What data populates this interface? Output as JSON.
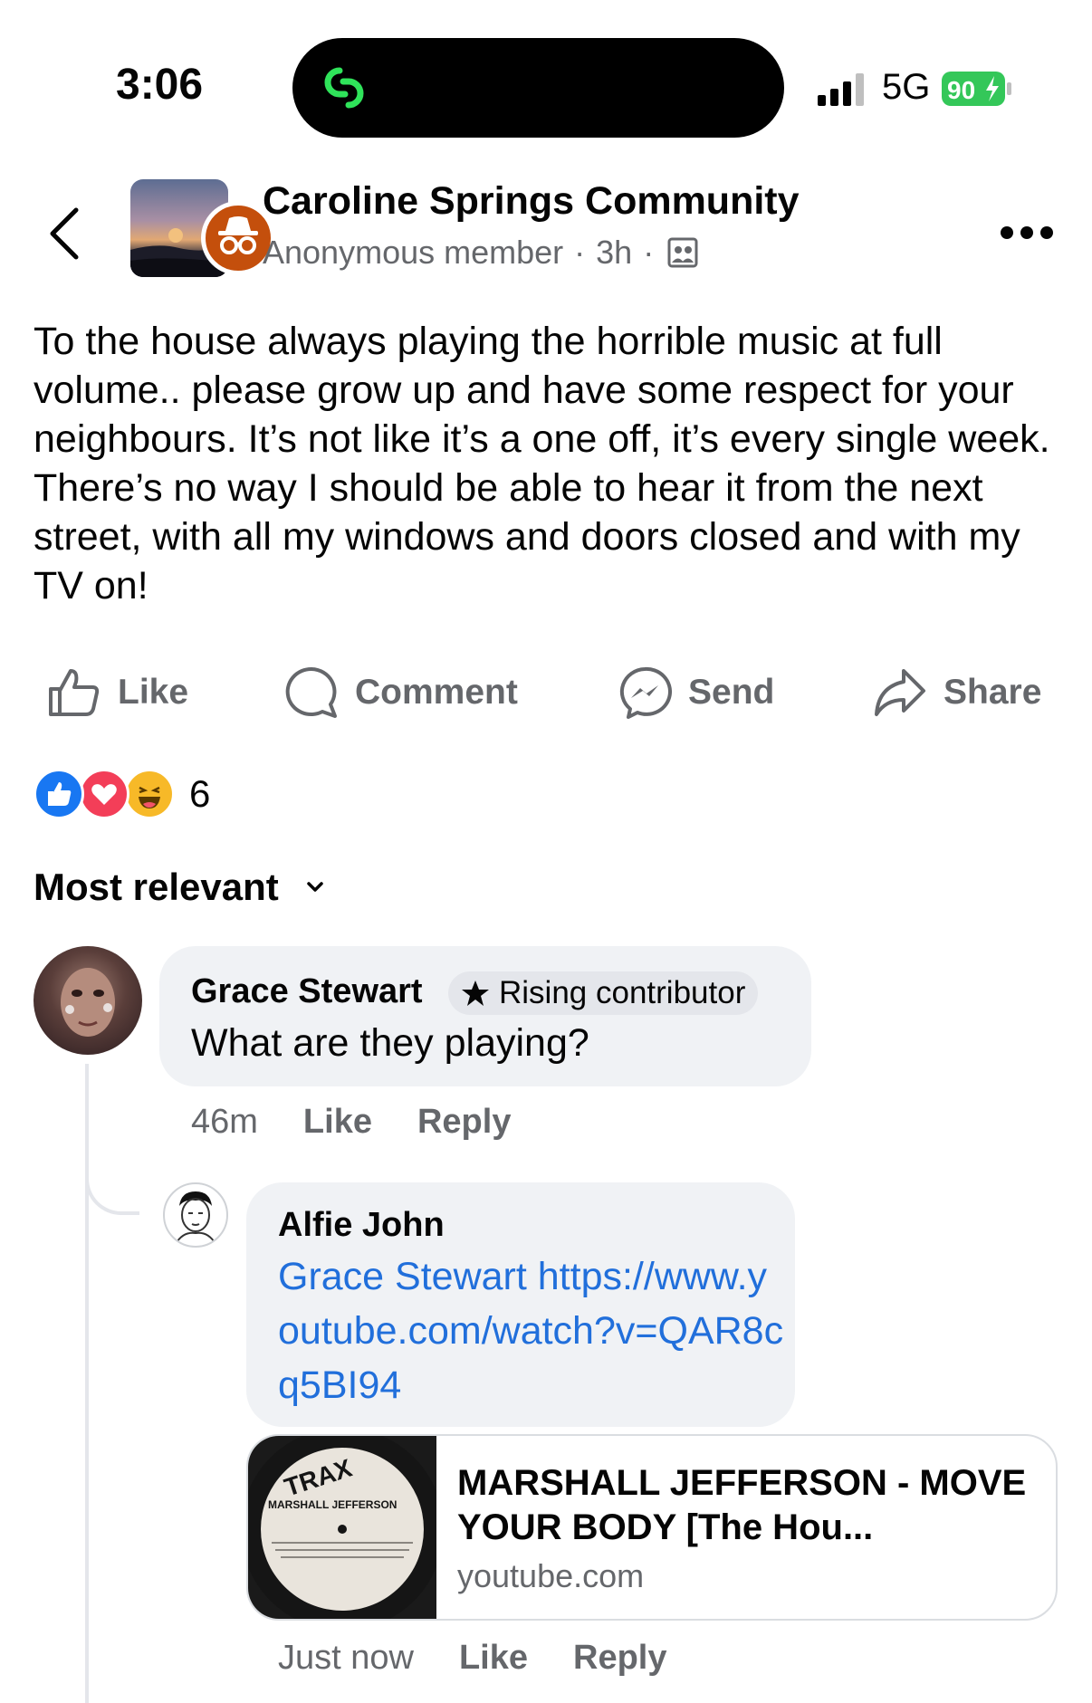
{
  "status_bar": {
    "time": "3:06",
    "network": "5G",
    "battery": "90",
    "battery_color": "#34c759"
  },
  "header": {
    "group_name": "Caroline Springs Community",
    "author": "Anonymous member",
    "time": "3h",
    "separator": "·",
    "audience_icon": "members-icon"
  },
  "post": {
    "text": "To the house always playing the horrible music at full volume.. please grow up and have some respect for your neighbours. It’s not like it’s a one off, it’s every single week. There’s no way I should be able to hear it from the next street, with all my windows and doors closed and with my TV on!"
  },
  "actions": {
    "like": "Like",
    "comment": "Comment",
    "send": "Send",
    "share": "Share"
  },
  "reactions": {
    "types": [
      "like-icon",
      "love-icon",
      "haha-icon"
    ],
    "count": "6"
  },
  "sort": {
    "label": "Most relevant"
  },
  "comments": [
    {
      "author": "Grace Stewart",
      "badge": "Rising contributor",
      "text": "What are they playing?",
      "time": "46m",
      "like": "Like",
      "reply": "Reply"
    },
    {
      "author": "Alfie John",
      "text": "Grace Stewart https://www.youtube.com/watch?v=QAR8cq5BI94",
      "preview": {
        "title": "MARSHALL JEFFERSON - MOVE YOUR BODY [The Hou...",
        "domain": "youtube.com",
        "thumb_title": "TRAX",
        "thumb_artist": "MARSHALL JEFFERSON"
      },
      "time": "Just now",
      "like": "Like",
      "reply": "Reply"
    }
  ],
  "colors": {
    "link": "#216fdb",
    "secondary_text": "#65676b",
    "bubble": "#f0f2f5",
    "anon_badge": "#c44f0c"
  }
}
